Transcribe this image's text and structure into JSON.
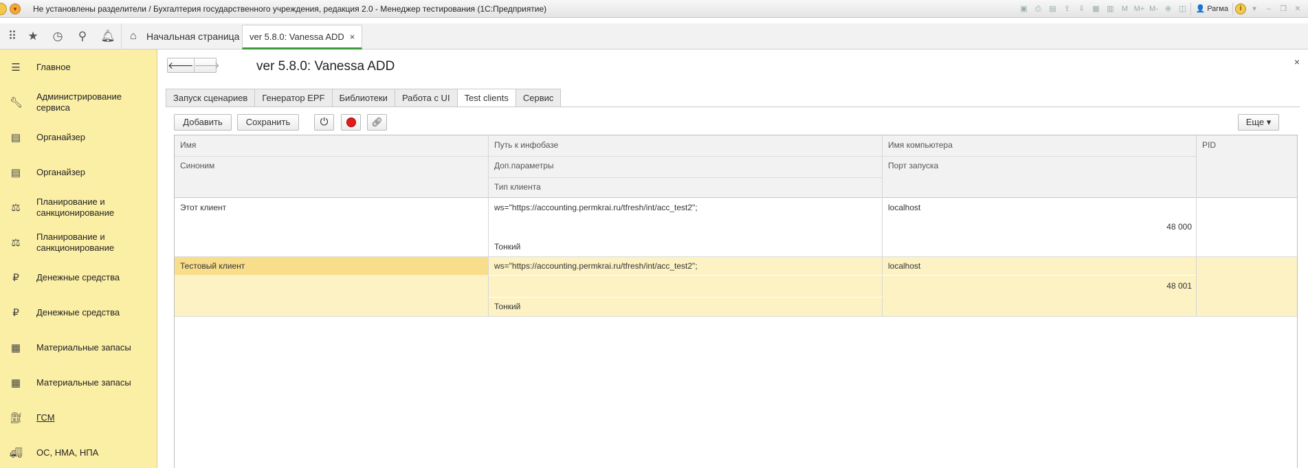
{
  "titlebar": {
    "title": "Не установлены разделители / Бухгалтерия государственного учреждения, редакция 2.0  - Менеджер тестирования (1С:Предприятие)",
    "user": "Рагма"
  },
  "topbar": {
    "home_label": "Начальная страница",
    "doc_tab_label": "ver 5.8.0: Vanessa ADD",
    "doc_tab_close": "×"
  },
  "sidebar": {
    "items": [
      {
        "label": "Главное",
        "icon": "menu-lines-icon"
      },
      {
        "label": "Администрирование сервиса",
        "icon": "wrench-icon"
      },
      {
        "label": "Органайзер",
        "icon": "clipboard-icon"
      },
      {
        "label": "Органайзер",
        "icon": "clipboard-icon"
      },
      {
        "label": "Планирование и санкционирование",
        "icon": "planning-icon"
      },
      {
        "label": "Планирование и санкционирование",
        "icon": "planning-icon"
      },
      {
        "label": "Денежные средства",
        "icon": "ruble-coin-icon"
      },
      {
        "label": "Денежные средства",
        "icon": "ruble-coin-icon"
      },
      {
        "label": "Материальные запасы",
        "icon": "grid-blocks-icon"
      },
      {
        "label": "Материальные запасы",
        "icon": "grid-blocks-icon"
      },
      {
        "label": "ГСМ",
        "icon": "fuel-icon"
      },
      {
        "label": "ОС, НМА, НПА",
        "icon": "truck-icon"
      }
    ]
  },
  "form": {
    "title": "ver 5.8.0: Vanessa ADD",
    "tabs": [
      "Запуск сценариев",
      "Генератор EPF",
      "Библиотеки",
      "Работа с UI",
      "Test clients",
      "Сервис"
    ],
    "active_tab": "Test clients",
    "buttons": {
      "add": "Добавить",
      "save": "Сохранить",
      "more": "Еще ▾"
    }
  },
  "table": {
    "headers": {
      "name": "Имя",
      "synonym": "Синоним",
      "path": "Путь к инфобазе",
      "params": "Доп.параметры",
      "client_type": "Тип клиента",
      "computer": "Имя компьютера",
      "port": "Порт запуска",
      "pid": "PID"
    },
    "rows": [
      {
        "name": "Этот клиент",
        "synonym": "",
        "path": "ws=\"https://accounting.permkrai.ru/tfresh/int/acc_test2\";",
        "params": "",
        "client_type": "Тонкий",
        "computer": "localhost",
        "port": "48 000",
        "pid": ""
      },
      {
        "name": "Тестовый клиент",
        "synonym": "",
        "path": "ws=\"https://accounting.permkrai.ru/tfresh/int/acc_test2\";",
        "params": "",
        "client_type": "Тонкий",
        "computer": "localhost",
        "port": "48 001",
        "pid": ""
      }
    ],
    "selected_row": 1
  },
  "colors": {
    "sidebar_bg": "#fbeea5",
    "selected_row_bg": "#fcf2c4",
    "selected_cell_bg": "#f8dd8a",
    "active_tab_underline": "#3c9a3c"
  }
}
